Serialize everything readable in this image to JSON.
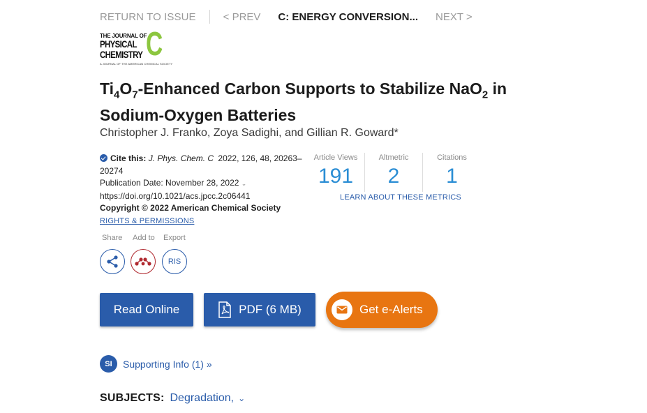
{
  "nav": {
    "return_label": "RETURN TO ISSUE",
    "prev_label": "< PREV",
    "current_label": "C: ENERGY CONVERSION...",
    "next_label": "NEXT >"
  },
  "journal_logo": {
    "line1": "THE JOURNAL OF",
    "line2": "PHYSICAL",
    "line3": "CHEMISTRY",
    "letter": "C",
    "tagline": "A JOURNAL OF THE AMERICAN CHEMICAL SOCIETY",
    "color": "#8cc63f"
  },
  "article": {
    "title_line1_a": "Ti",
    "title_sub1": "4",
    "title_line1_b": "O",
    "title_sub2": "7",
    "title_line1_c": "-Enhanced Carbon Supports to Stabilize NaO",
    "title_sub3": "2",
    "title_line1_d": " in",
    "title_line2": "Sodium-Oxygen Batteries",
    "authors": "Christopher J. Franko, Zoya Sadighi, and Gillian R. Goward*"
  },
  "citation": {
    "cite_label": "Cite this:",
    "journal": "J. Phys. Chem. C",
    "details": "2022, 126, 48, 20263–20274",
    "pub_date": "Publication Date: November 28, 2022",
    "doi": "https://doi.org/10.1021/acs.jpcc.2c06441",
    "copyright": "Copyright © 2022 American Chemical Society",
    "rights_link": "RIGHTS & PERMISSIONS"
  },
  "metrics": {
    "items": [
      {
        "label": "Article Views",
        "value": "191"
      },
      {
        "label": "Altmetric",
        "value": "2"
      },
      {
        "label": "Citations",
        "value": "1"
      }
    ],
    "learn_link": "LEARN ABOUT THESE METRICS"
  },
  "actions": {
    "share_label": "Share",
    "add_to_label": "Add to",
    "export_label": "Export",
    "ris_label": "RIS",
    "share_icon": "share-icon",
    "mendeley_icon": "mendeley-icon"
  },
  "buttons": {
    "read_online": "Read Online",
    "pdf": "PDF (6 MB)",
    "alerts": "Get e-Alerts"
  },
  "supporting": {
    "badge": "SI",
    "label": "Supporting Info (1) »"
  },
  "subjects": {
    "label": "SUBJECTS:",
    "value": "Degradation,"
  },
  "colors": {
    "primary_blue": "#2a5caa",
    "metric_blue": "#2a8dd4",
    "alert_orange": "#e87511",
    "mendeley_red": "#b02a30"
  }
}
